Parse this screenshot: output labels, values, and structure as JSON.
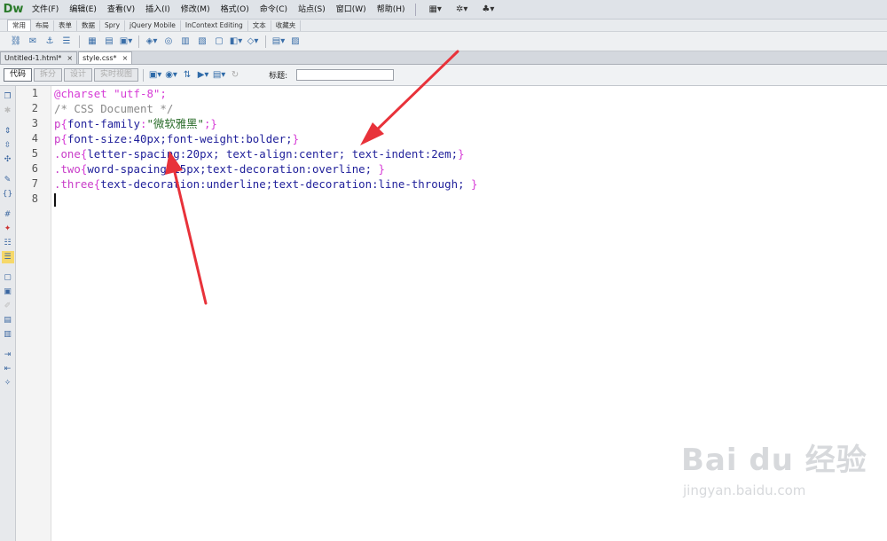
{
  "app": {
    "logo": "Dw"
  },
  "menubar": {
    "items": [
      "文件(F)",
      "编辑(E)",
      "查看(V)",
      "插入(I)",
      "修改(M)",
      "格式(O)",
      "命令(C)",
      "站点(S)",
      "窗口(W)",
      "帮助(H)"
    ],
    "icons": [
      "layout-icon",
      "gear-icon",
      "site-icon"
    ]
  },
  "insert_categories": [
    "常用",
    "布局",
    "表单",
    "数据",
    "Spry",
    "jQuery Mobile",
    "InContext Editing",
    "文本",
    "收藏夹"
  ],
  "document_tabs": [
    {
      "label": "Untitled-1.html*",
      "active": false
    },
    {
      "label": "style.css*",
      "active": true
    }
  ],
  "view_buttons": [
    "代码",
    "拆分",
    "设计",
    "实时视图"
  ],
  "title_field": {
    "label": "标题:",
    "value": ""
  },
  "line_numbers": [
    "1",
    "2",
    "3",
    "4",
    "5",
    "6",
    "7",
    "8"
  ],
  "code": {
    "l1": {
      "a": "@charset ",
      "b": "\"utf-8\"",
      "c": ";"
    },
    "l2": {
      "a": "/* CSS Document */"
    },
    "l3": {
      "sel": "p",
      "o": "{",
      "prop": "font-family",
      "colon": ":",
      "val": "\"微软雅黑\"",
      "end": ";}"
    },
    "l4": {
      "sel": "p",
      "o": "{",
      "body": "font-size:40px;font-weight:bolder;",
      "end": "}"
    },
    "l5": {
      "sel": ".one",
      "o": "{",
      "body": "letter-spacing:20px; text-align:center; text-indent:2em;",
      "end": "}"
    },
    "l6": {
      "sel": ".two",
      "o": "{",
      "body": "word-spacing:15px;text-decoration:overline; ",
      "end": "}"
    },
    "l7": {
      "sel": ".three",
      "o": "{",
      "body": "text-decoration:underline;text-decoration:line-through; ",
      "end": "}"
    }
  },
  "colors": {
    "annotation_arrow": "#e8323a",
    "selector": "#c83cc8",
    "property": "#1f1f9a",
    "string": "#2b6d2b",
    "comment": "#8a8a8a"
  },
  "watermark": {
    "main": "Bai du 经验",
    "sub": "jingyan.baidu.com"
  }
}
